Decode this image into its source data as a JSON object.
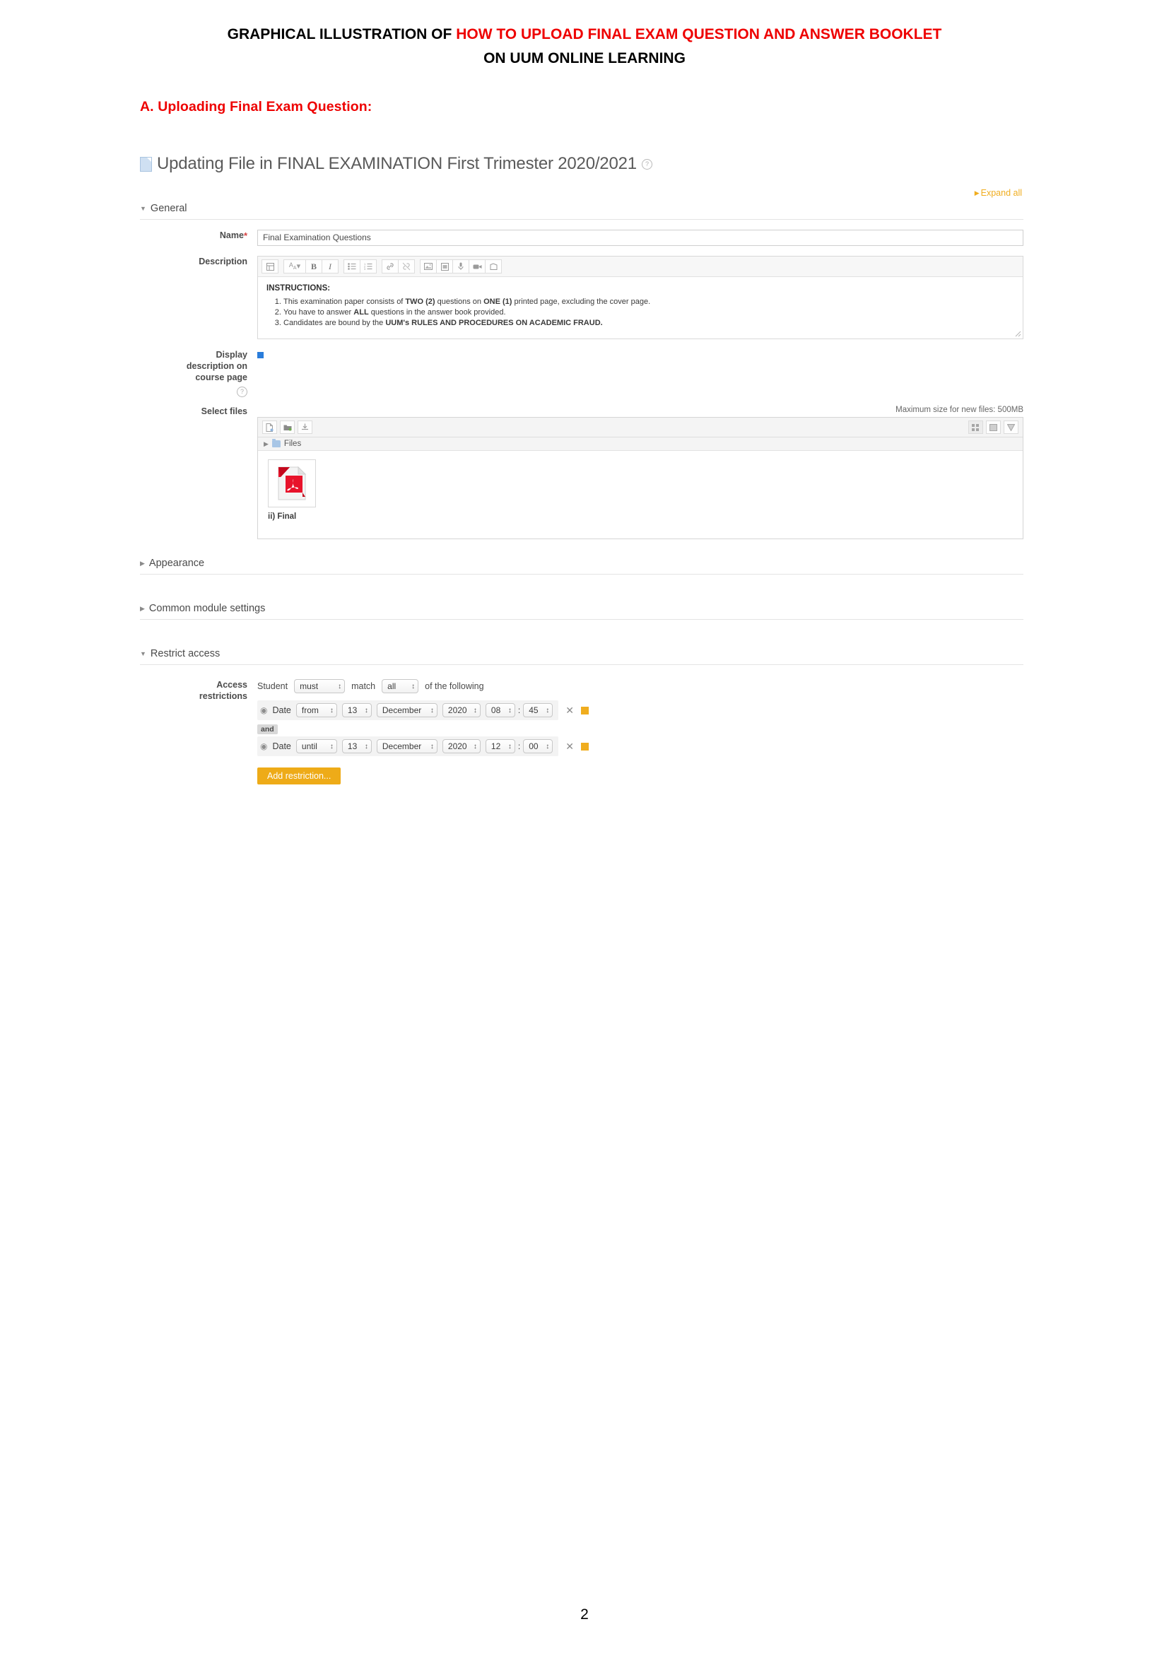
{
  "document": {
    "title_black_1": "GRAPHICAL ILLUSTRATION OF ",
    "title_red": "HOW TO UPLOAD FINAL EXAM QUESTION AND ANSWER BOOKLET",
    "title_black_2": "ON UUM ONLINE LEARNING",
    "section_heading": "A. Uploading Final Exam Question:",
    "page_number": "2"
  },
  "moodle": {
    "page_heading": "Updating File in FINAL EXAMINATION First Trimester 2020/2021",
    "expand_all": "Expand all",
    "sections": {
      "general": "General",
      "appearance": "Appearance",
      "common_module_settings": "Common module settings",
      "restrict_access": "Restrict access"
    },
    "name_field": {
      "label": "Name",
      "required_mark": "*",
      "value": "Final Examination Questions"
    },
    "description_field": {
      "label": "Description",
      "toolbar": [
        {
          "name": "paragraph-style-button",
          "glyph": "style"
        },
        {
          "name": "font-size-dropdown",
          "glyph": "Aa"
        },
        {
          "name": "bold-button",
          "glyph": "B"
        },
        {
          "name": "italic-button",
          "glyph": "I"
        },
        {
          "name": "bullet-list-button",
          "glyph": "ul"
        },
        {
          "name": "numbered-list-button",
          "glyph": "ol"
        },
        {
          "name": "link-button",
          "glyph": "link"
        },
        {
          "name": "unlink-button",
          "glyph": "unlink"
        },
        {
          "name": "insert-image-button",
          "glyph": "image"
        },
        {
          "name": "manage-files-button",
          "glyph": "file"
        },
        {
          "name": "record-audio-button",
          "glyph": "mic"
        },
        {
          "name": "record-video-button",
          "glyph": "video"
        },
        {
          "name": "insert-media-button",
          "glyph": "media"
        }
      ],
      "content": {
        "heading": "INSTRUCTIONS:",
        "items": [
          "This examination paper consists of TWO (2) questions on ONE (1) printed page, excluding the cover page.",
          "You have to answer ALL questions in the answer book provided.",
          "Candidates are bound by the UUM's RULES AND PROCEDURES ON ACADEMIC FRAUD."
        ]
      }
    },
    "display_description": {
      "label_line1": "Display",
      "label_line2": "description on",
      "label_line3": "course page",
      "checked": true
    },
    "select_files": {
      "label": "Select files",
      "max_size_text": "Maximum size for new files: 500MB",
      "path_label": "Files",
      "toolbar_left": [
        "add-file-icon",
        "create-folder-icon",
        "download-all-icon"
      ],
      "toolbar_right": [
        "view-icons-icon",
        "view-list-icon",
        "view-tree-icon"
      ],
      "files": [
        {
          "name": "ii) Final",
          "type": "pdf"
        }
      ]
    },
    "restrict_access": {
      "label_line1": "Access",
      "label_line2": "restrictions",
      "prefix": "Student",
      "must_value": "must",
      "middle": "match",
      "match_value": "all",
      "suffix": "of the following",
      "operator": "and",
      "conditions": [
        {
          "type": "Date",
          "direction": "from",
          "day": "13",
          "month": "December",
          "year": "2020",
          "hour": "08",
          "minute": "45"
        },
        {
          "type": "Date",
          "direction": "until",
          "day": "13",
          "month": "December",
          "year": "2020",
          "hour": "12",
          "minute": "00"
        }
      ],
      "add_button": "Add restriction..."
    }
  },
  "colors": {
    "accent_red": "#ee0000",
    "accent_orange": "#eeab18",
    "link_orange": "#f0ad1f",
    "checkbox_blue": "#2a7ddb"
  }
}
